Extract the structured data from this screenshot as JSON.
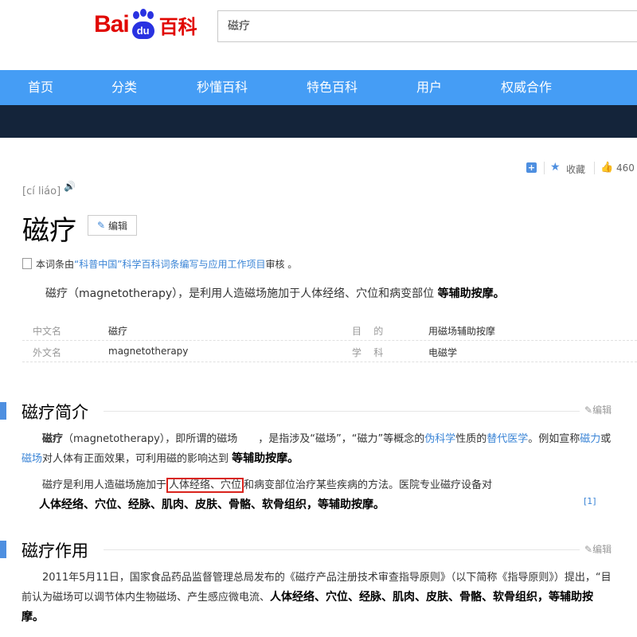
{
  "header": {
    "logo_text_left": "Bai",
    "logo_text_paw": "du",
    "logo_text_right": "百科",
    "search_value": "磁疗"
  },
  "nav": {
    "items": [
      "首页",
      "分类",
      "秒懂百科",
      "特色百科",
      "用户",
      "权威合作"
    ]
  },
  "tools": {
    "collect_label": "收藏",
    "like_count": "460"
  },
  "entry": {
    "pinyin": "[cí liáo]",
    "title": "磁疗",
    "edit_label": "编辑",
    "review_prefix": "本词条由",
    "review_link": "“科普中国”科学百科词条编写与应用工作项目",
    "review_suffix": "审核 。",
    "summary_text": "磁疗（magnetotherapy），是利用人造磁场施加于人体经络、穴位和病变部位",
    "summary_bold": "等辅助按摩。"
  },
  "infobox": {
    "rows": [
      {
        "k1": "中文名",
        "v1": "磁疗",
        "k2": "目    的",
        "v2": "用磁场辅助按摩"
      },
      {
        "k1": "外文名",
        "v1": "magnetotherapy",
        "k2": "学    科",
        "v2": "电磁学"
      }
    ]
  },
  "section1": {
    "title": "磁疗简介",
    "edit_label": "编辑",
    "p1_bold": "磁疗",
    "p1_a": "（magnetotherapy），即所谓的磁场　　，是指涉及“磁场”，“磁力”等概念的",
    "p1_link1": "伪科学",
    "p1_b": "性质的",
    "p1_link2": "替代医学",
    "p1_c": "。例如宣称",
    "p1_link3": "磁力",
    "p1_d": "或",
    "p1_link4": "磁场",
    "p1_e": "对人体有正面效果，可利用磁的影响达到",
    "p1_bold2": "等辅助按摩。",
    "p2_a": "磁疗是利用人造磁场施加于",
    "p2_highlight": "人体经络、穴位",
    "p2_b": "和病变部位治疗某些疾病的方法。医院专业磁疗设备对",
    "p2_bold": "人体经络、穴位、经脉、肌肉、皮肤、骨骼、软骨组织，等辅助按摩。",
    "ref": "[1]"
  },
  "section2": {
    "title": "磁疗作用",
    "edit_label": "编辑",
    "p_a": "2011年5月11日，国家食品药品监督管理总局发布的《磁疗产品注册技术审查指导原则》（以下简称《指导原则》）提出，“目前认为磁场可以调节体内生物磁场、产生感应微电流、",
    "p_bold": "人体经络、穴位、经脉、肌肉、皮肤、骨骼、软骨组织，等辅助按摩。"
  }
}
